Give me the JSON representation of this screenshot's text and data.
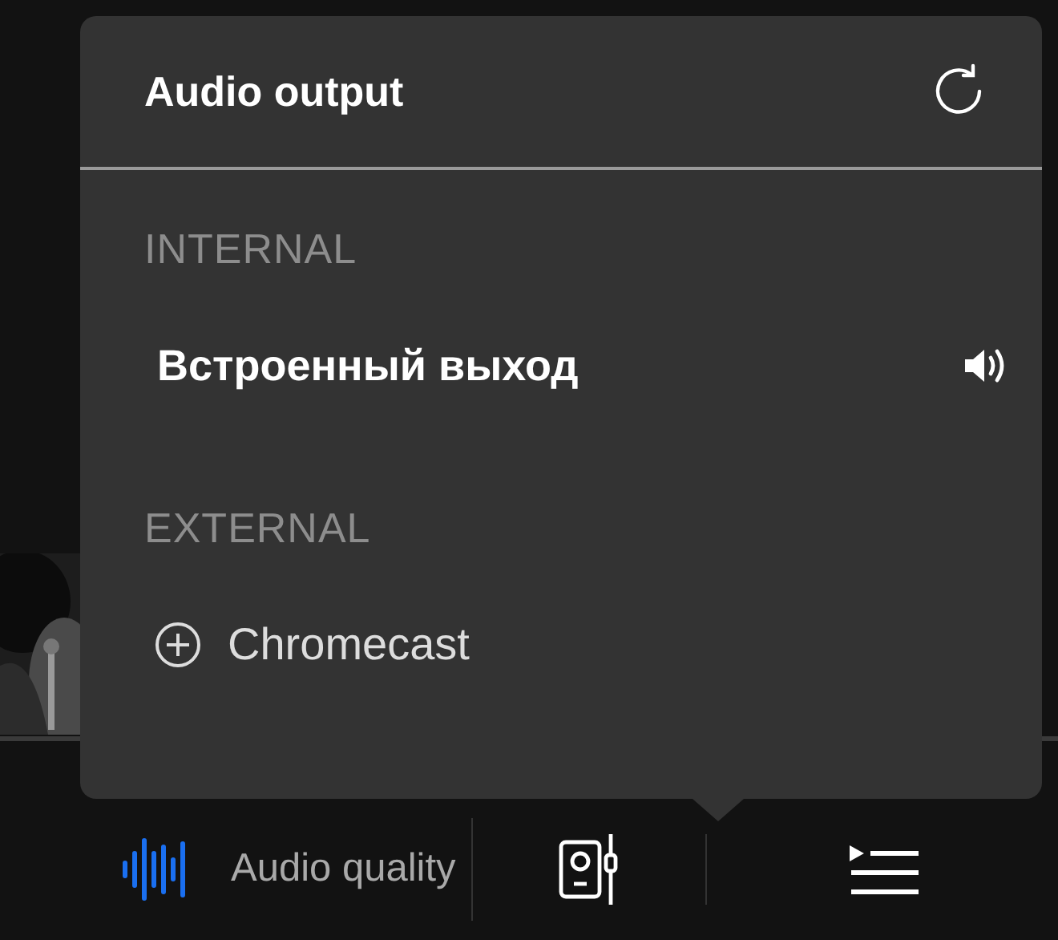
{
  "popup": {
    "title": "Audio output",
    "sections": [
      {
        "heading": "INTERNAL",
        "devices": [
          {
            "name": "Встроенный выход",
            "selected": true
          }
        ]
      },
      {
        "heading": "EXTERNAL",
        "devices": [
          {
            "name": "Chromecast",
            "selected": false
          }
        ]
      }
    ]
  },
  "player_bar": {
    "audio_quality": "Audio quality"
  }
}
